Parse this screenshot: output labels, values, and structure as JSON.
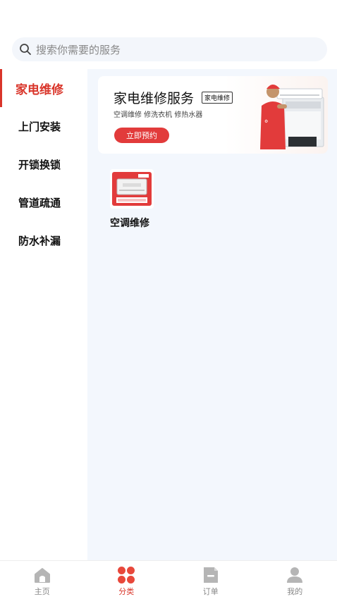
{
  "search": {
    "placeholder": "搜索你需要的服务"
  },
  "sidebar": {
    "items": [
      {
        "label": "家电维修",
        "active": true
      },
      {
        "label": "上门安装"
      },
      {
        "label": "开锁换锁"
      },
      {
        "label": "管道疏通"
      },
      {
        "label": "防水补漏"
      }
    ]
  },
  "banner": {
    "title": "家电维修服务",
    "tag": "家电维修",
    "subtitle": "空调维修  修洗衣机  修热水器",
    "button": "立即预约"
  },
  "services": [
    {
      "label": "空调维修",
      "thumb_badge": "空调维修服务"
    }
  ],
  "tabbar": {
    "items": [
      {
        "label": "主页",
        "icon": "home-icon"
      },
      {
        "label": "分类",
        "icon": "category-icon",
        "active": true
      },
      {
        "label": "订单",
        "icon": "order-icon"
      },
      {
        "label": "我的",
        "icon": "profile-icon"
      }
    ]
  },
  "colors": {
    "accent": "#d9352a",
    "button": "#e23b3b",
    "content_bg": "#f3f7fd",
    "inactive": "#888888"
  }
}
